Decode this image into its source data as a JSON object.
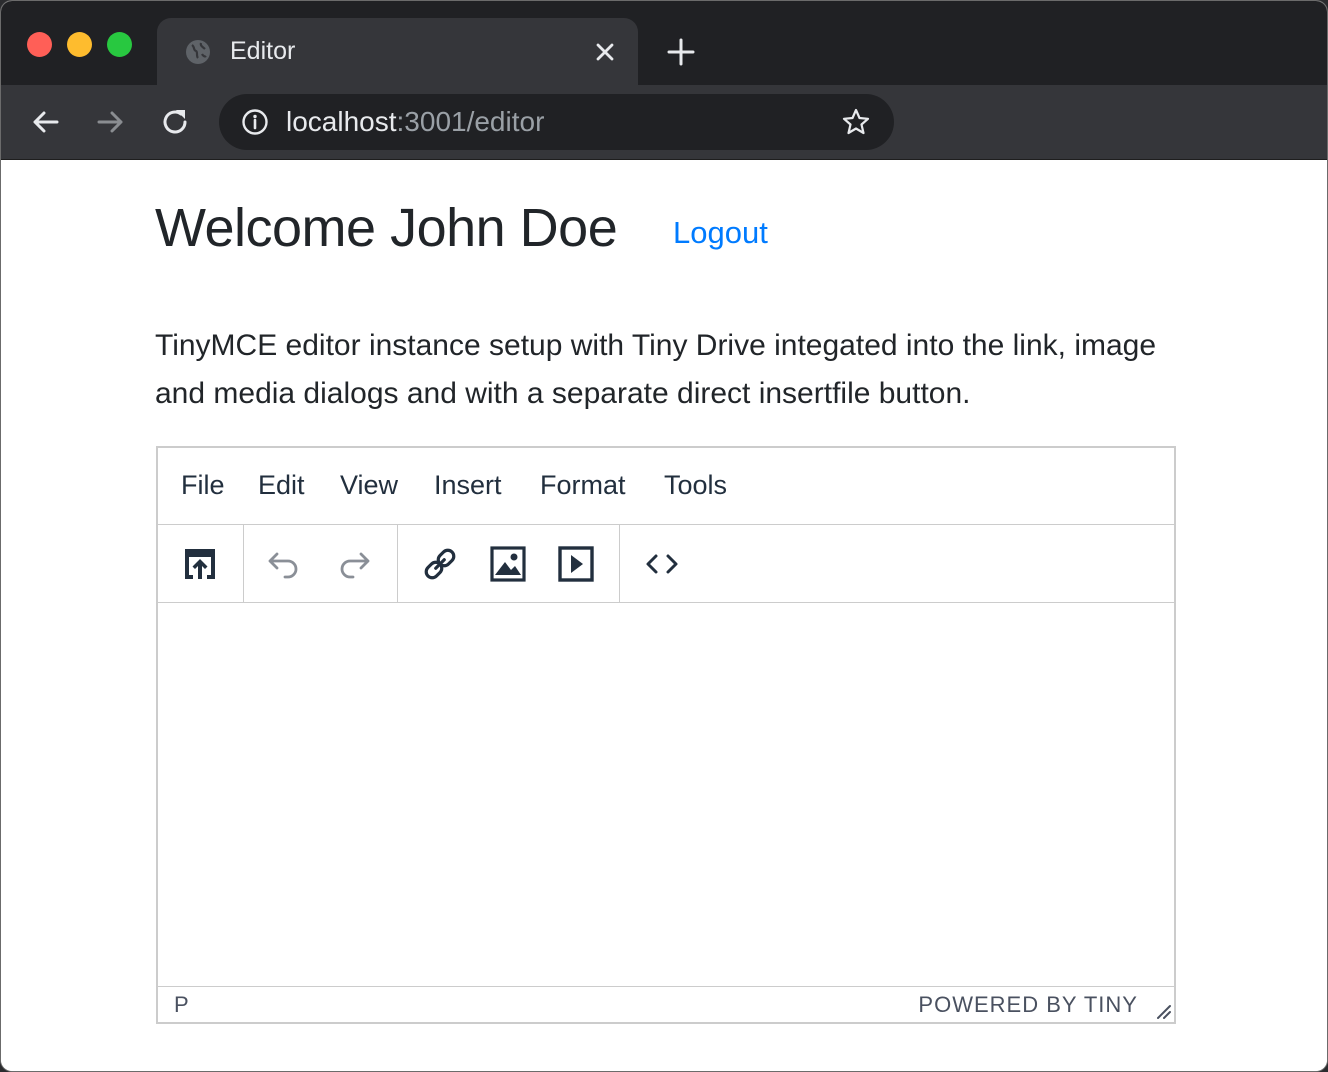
{
  "browser": {
    "tab": {
      "title": "Editor"
    },
    "address": {
      "host": "localhost",
      "rest": ":3001/editor"
    }
  },
  "page": {
    "heading": "Welcome John Doe",
    "logout_label": "Logout",
    "description": "TinyMCE editor instance setup with Tiny Drive integated into the link, image and media dialogs and with a separate direct insertfile button."
  },
  "editor": {
    "menu": [
      {
        "label": "File"
      },
      {
        "label": "Edit"
      },
      {
        "label": "View"
      },
      {
        "label": "Insert"
      },
      {
        "label": "Format"
      },
      {
        "label": "Tools"
      }
    ],
    "toolbar": [
      {
        "icon": "insertfile-icon"
      },
      {
        "icon": "undo-icon",
        "disabled": true
      },
      {
        "icon": "redo-icon",
        "disabled": true
      },
      {
        "icon": "link-icon"
      },
      {
        "icon": "image-icon"
      },
      {
        "icon": "media-icon"
      },
      {
        "icon": "code-icon"
      }
    ],
    "status": {
      "path": "P",
      "branding": "POWERED BY TINY"
    }
  },
  "colors": {
    "link": "#007bff",
    "text": "#212529",
    "editor_icon": "#222f3e",
    "disabled_icon": "#8a8f97"
  }
}
